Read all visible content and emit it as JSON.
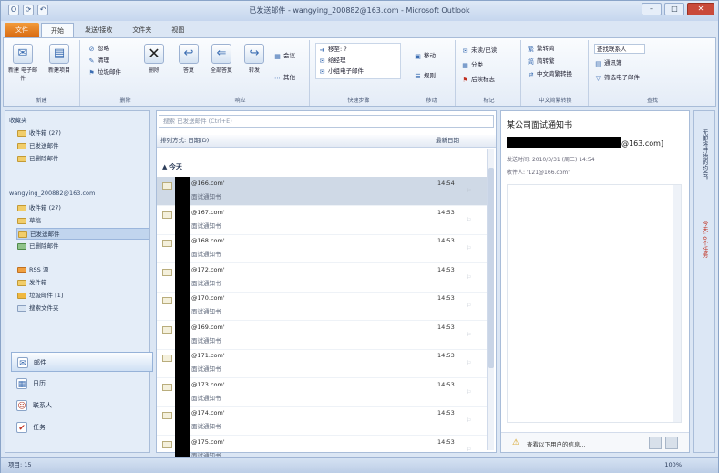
{
  "window": {
    "title": "已发送邮件 - wangying_200882@163.com - Microsoft Outlook"
  },
  "tabs": [
    "文件",
    "开始",
    "发送/接收",
    "文件夹",
    "视图"
  ],
  "ribbon": {
    "new": {
      "new_email": "新建\n电子邮件",
      "new_items": "新建项目",
      "label": "新建"
    },
    "delete": {
      "ignore": "忽略",
      "cleanup": "清理",
      "junk": "垃圾邮件",
      "delete": "删除",
      "label": "删除"
    },
    "respond": {
      "reply": "答复",
      "reply_all": "全部答复",
      "forward": "转发",
      "meeting": "会议",
      "more": "其他",
      "label": "响应"
    },
    "quicksteps": {
      "items": [
        "移至: ?",
        "给经理",
        "小组电子邮件"
      ],
      "label": "快速步骤"
    },
    "move": {
      "move": "移动",
      "rules": "规则",
      "label": "移动"
    },
    "tags": {
      "unread": "未读/已读",
      "categorize": "分类",
      "followup": "后续标志",
      "label": "标记"
    },
    "chinese": {
      "t2s": "繁转简",
      "s2t": "简转繁",
      "convert": "中文简繁转换",
      "label": "中文简繁转换"
    },
    "find": {
      "contact": "查找联系人",
      "address_book": "通讯簿",
      "filter": "筛选电子邮件",
      "label": "查找"
    }
  },
  "nav": {
    "favorites_header": "收藏夹",
    "favorites": [
      "收件箱 (27)",
      "已发送邮件",
      "已删除邮件"
    ],
    "account_header": "wangying_200882@163.com",
    "folders": [
      "收件箱 (27)",
      "草稿",
      "已发送邮件",
      "已删除邮件",
      "RSS 源",
      "发件箱",
      "垃圾邮件 [1]",
      "搜索文件夹"
    ],
    "bottom": [
      "邮件",
      "日历",
      "联系人",
      "任务"
    ]
  },
  "list": {
    "search_placeholder": "搜索 已发送邮件 (Ctrl+E)",
    "col_arrange": "排列方式: 日期(D)",
    "col_order": "最新日期",
    "group_today": "今天",
    "rows": [
      {
        "from": "@166.com'",
        "subject": "面试通知书",
        "time": "14:54"
      },
      {
        "from": "@167.com'",
        "subject": "面试通知书",
        "time": "14:53"
      },
      {
        "from": "@168.com'",
        "subject": "面试通知书",
        "time": "14:53"
      },
      {
        "from": "@172.com'",
        "subject": "面试通知书",
        "time": "14:53"
      },
      {
        "from": "@170.com'",
        "subject": "面试通知书",
        "time": "14:53"
      },
      {
        "from": "@169.com'",
        "subject": "面试通知书",
        "time": "14:53"
      },
      {
        "from": "@171.com'",
        "subject": "面试通知书",
        "time": "14:53"
      },
      {
        "from": "@173.com'",
        "subject": "面试通知书",
        "time": "14:53"
      },
      {
        "from": "@174.com'",
        "subject": "面试通知书",
        "time": "14:53"
      },
      {
        "from": "@175.com'",
        "subject": "面试通知书",
        "time": "14:53"
      }
    ]
  },
  "reading": {
    "subject": "某公司面试通知书",
    "sender_suffix": "@163.com]",
    "sent_label": "发送时间:",
    "sent_value": "2010/3/31 (周三) 14:54",
    "to_label": "收件人:",
    "to_value": "'121@166.com'",
    "footer_text": "查看以下用户的信息..."
  },
  "todo": {
    "label1": "无即将开始的约会。",
    "label2": "今天: 0个任务"
  },
  "status": {
    "items": "项目: 15",
    "zoom": "100%"
  }
}
